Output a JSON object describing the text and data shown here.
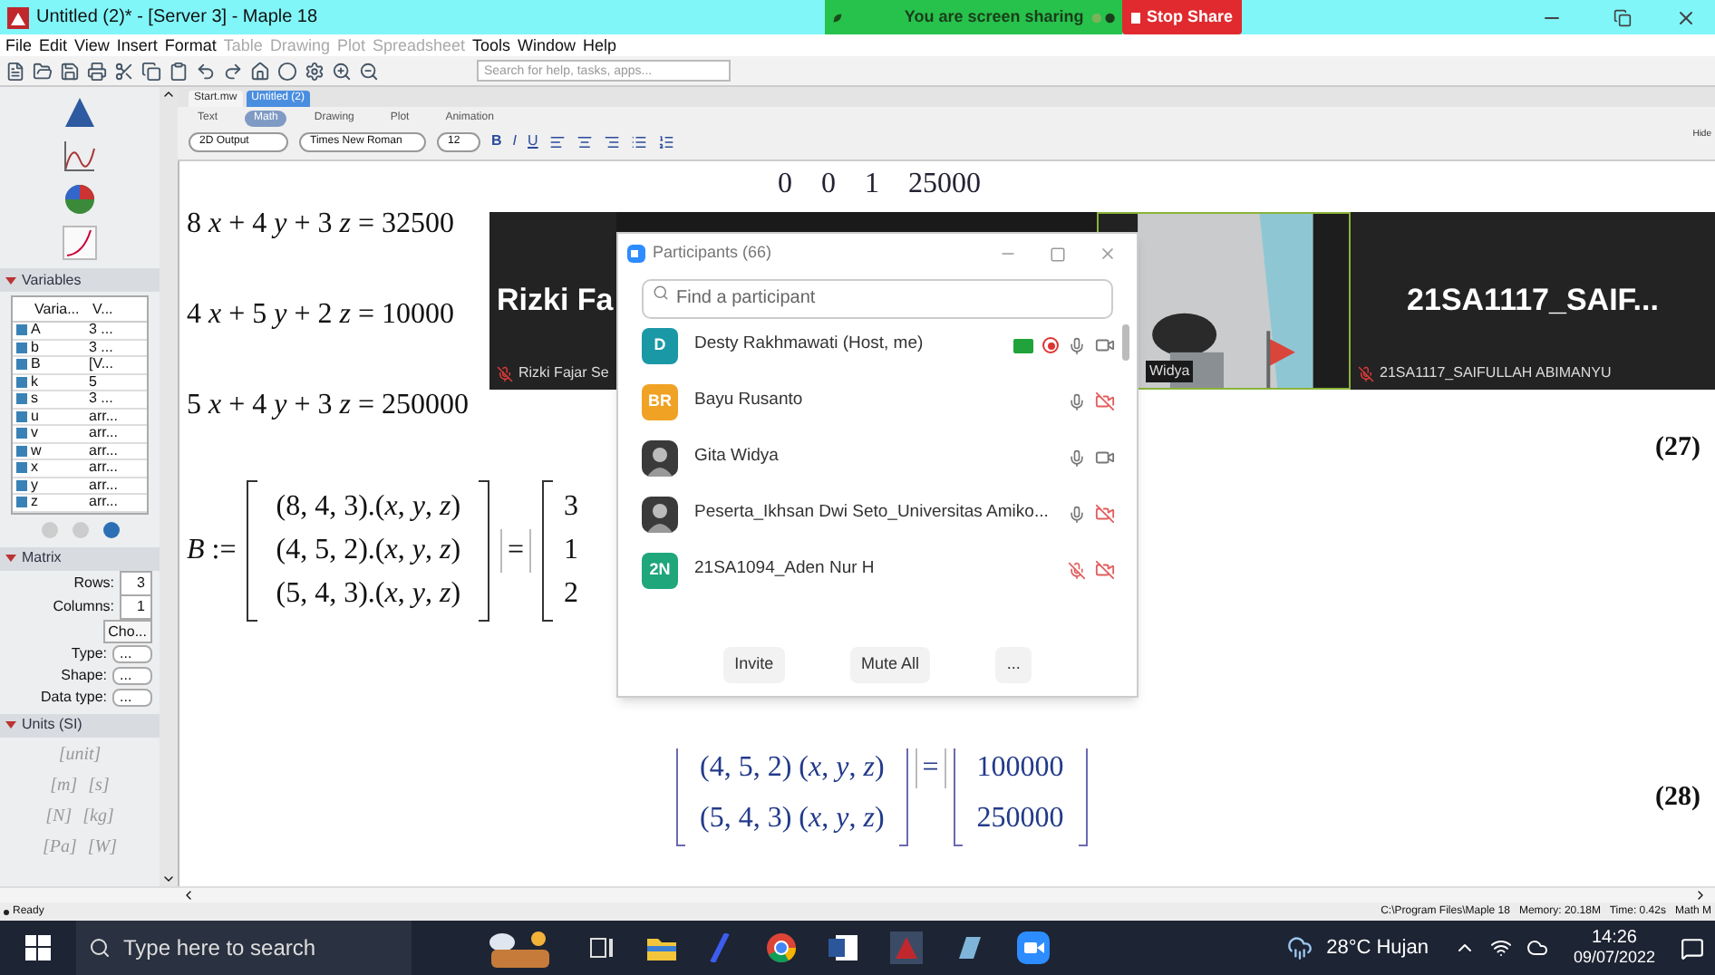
{
  "window": {
    "title": "Untitled (2)* - [Server 3] - Maple 18"
  },
  "share_banner": {
    "status": "You are screen sharing",
    "stop_button": "Stop Share"
  },
  "menu": [
    {
      "label": "File",
      "disabled": false
    },
    {
      "label": "Edit",
      "disabled": false
    },
    {
      "label": "View",
      "disabled": false
    },
    {
      "label": "Insert",
      "disabled": false
    },
    {
      "label": "Format",
      "disabled": false
    },
    {
      "label": "Table",
      "disabled": true
    },
    {
      "label": "Drawing",
      "disabled": true
    },
    {
      "label": "Plot",
      "disabled": true
    },
    {
      "label": "Spreadsheet",
      "disabled": true
    },
    {
      "label": "Tools",
      "disabled": false
    },
    {
      "label": "Window",
      "disabled": false
    },
    {
      "label": "Help",
      "disabled": false
    }
  ],
  "toolbar": {
    "search_placeholder": "Search for help, tasks, apps..."
  },
  "palette": {
    "variables": {
      "title": "Variables",
      "expanded": true,
      "columns": [
        "Varia...",
        "V..."
      ],
      "rows": [
        {
          "name": "A",
          "value": "3 ..."
        },
        {
          "name": "b",
          "value": "3 ..."
        },
        {
          "name": "B",
          "value": "[V..."
        },
        {
          "name": "k",
          "value": "5"
        },
        {
          "name": "s",
          "value": "3 ..."
        },
        {
          "name": "u",
          "value": "arr..."
        },
        {
          "name": "v",
          "value": "arr..."
        },
        {
          "name": "w",
          "value": "arr..."
        },
        {
          "name": "x",
          "value": "arr..."
        },
        {
          "name": "y",
          "value": "arr..."
        },
        {
          "name": "z",
          "value": "arr..."
        }
      ]
    },
    "matrix": {
      "title": "Matrix",
      "expanded": true,
      "rows_label": "Rows:",
      "rows_value": "3",
      "columns_label": "Columns:",
      "columns_value": "1",
      "choose_button": "Cho...",
      "fields": [
        {
          "label": "Type:",
          "value": "..."
        },
        {
          "label": "Shape:",
          "value": "..."
        },
        {
          "label": "Data type:",
          "value": "..."
        }
      ]
    },
    "units": {
      "title": "Units (SI)",
      "expanded": true,
      "rows": [
        [
          "[unit]"
        ],
        [
          "[m]",
          "[s]"
        ],
        [
          "[N]",
          "[kg]"
        ],
        [
          "[Pa]",
          "[W]"
        ]
      ]
    }
  },
  "doc_tabs": [
    {
      "label": "Start.mw",
      "selected": false
    },
    {
      "label": "Untitled (2)",
      "selected": true
    }
  ],
  "context_bar": {
    "modes": [
      {
        "label": "Text",
        "selected": false
      },
      {
        "label": "Math",
        "selected": true
      },
      {
        "label": "Drawing",
        "selected": false
      },
      {
        "label": "Plot",
        "selected": false
      },
      {
        "label": "Animation",
        "selected": false
      }
    ],
    "style": "2D Output",
    "font": "Times New Roman",
    "size": "12",
    "format_buttons": [
      {
        "kind": "bold",
        "label": "B"
      },
      {
        "kind": "italic",
        "label": "I"
      },
      {
        "kind": "underline",
        "label": "U"
      }
    ],
    "hide": "Hide"
  },
  "document": {
    "fragment": "0    0    1    25000",
    "equations": [
      "8 *x* + 4 *y* + 3 *z* = 32500",
      "4 *x* + 5 *y* + 2 *z* = 10000",
      "5 *x* + 4 *y* + 3 *z* = 250000"
    ],
    "label_27": "(27)",
    "b_matrix": {
      "lhs": "*B* :=",
      "rows": [
        "(8, 4, 3).(*x*, *y*, *z*)",
        "(4, 5, 2).(*x*, *y*, *z*)",
        "(5, 4, 3).(*x*, *y*, *z*)"
      ],
      "equals": "=",
      "rhs": [
        "3",
        "1",
        "2"
      ]
    },
    "result_matrix": {
      "rows": [
        {
          "lhs": "(4, 5, 2) (*x*, *y*, *z*)",
          "rhs": "100000"
        },
        {
          "lhs": "(5, 4, 3) (*x*, *y*, *z*)",
          "rhs": "250000"
        }
      ],
      "equals": "="
    },
    "label_28": "(28)"
  },
  "video_strip": [
    {
      "kind": "name",
      "name": "Rizki Fa",
      "label": "Rizki Fajar Se",
      "muted": true
    },
    {
      "kind": "video",
      "label": "Widya"
    },
    {
      "kind": "name",
      "name": "21SA1117_SAIF...",
      "label": "21SA1117_SAIFULLAH ABIMANYU",
      "muted": true
    }
  ],
  "participants": {
    "title": "Participants (66)",
    "search_placeholder": "Find a participant",
    "rows": [
      {
        "kind": "initials",
        "initials": "D",
        "color": "#1b98a6",
        "name": "Desty Rakhmawati (Host, me)",
        "sharing": true,
        "recording": true,
        "muted": false,
        "video_off": false
      },
      {
        "kind": "initials",
        "initials": "BR",
        "color": "#f0a224",
        "name": "Bayu Rusanto",
        "sharing": false,
        "recording": false,
        "muted": false,
        "video_off": true
      },
      {
        "name": "Gita Widya",
        "sharing": false,
        "recording": false,
        "muted": false,
        "video_off": false
      },
      {
        "name": "Peserta_Ikhsan Dwi Seto_Universitas Amiko...",
        "sharing": false,
        "recording": false,
        "muted": false,
        "video_off": true
      },
      {
        "kind": "initials",
        "initials": "2N",
        "color": "#1fa67a",
        "name": "21SA1094_Aden Nur H",
        "sharing": false,
        "recording": false,
        "muted": true,
        "video_off": true
      }
    ],
    "buttons": [
      "Invite",
      "Mute All",
      "..."
    ]
  },
  "status_bar": {
    "state": "Ready",
    "info": "C:\\Program Files\\Maple 18   Memory: 20.18M   Time: 0.42s   Math M"
  },
  "taskbar": {
    "search_placeholder": "Type here to search",
    "weather": "28°C Hujan",
    "time": "14:26",
    "date": "09/07/2022"
  }
}
